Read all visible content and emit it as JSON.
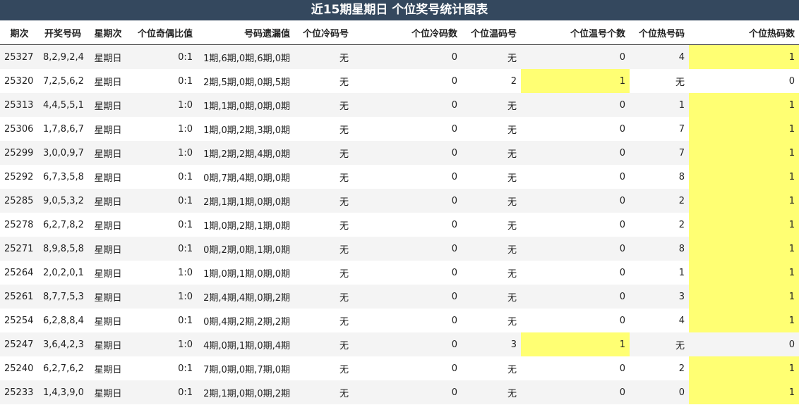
{
  "title": "近15期星期日 个位奖号统计图表",
  "columns": [
    "期次",
    "开奖号码",
    "星期次",
    "个位奇偶比值",
    "号码遗漏值",
    "个位冷码号",
    "个位冷码数",
    "个位温码号",
    "个位温号个数",
    "个位热号码",
    "个位热码数"
  ],
  "rows": [
    {
      "issue": "25327",
      "numbers": "8,2,9,2,4",
      "weekday": "星期日",
      "odd_even": "0:1",
      "omission": "1期,6期,0期,6期,0期",
      "cold_num": "无",
      "cold_count": "0",
      "warm_num": "无",
      "warm_count": "0",
      "hot_num": "4",
      "hot_count": "1"
    },
    {
      "issue": "25320",
      "numbers": "7,2,5,6,2",
      "weekday": "星期日",
      "odd_even": "0:1",
      "omission": "2期,5期,0期,0期,5期",
      "cold_num": "无",
      "cold_count": "0",
      "warm_num": "2",
      "warm_count": "1",
      "hot_num": "无",
      "hot_count": "0"
    },
    {
      "issue": "25313",
      "numbers": "4,4,5,5,1",
      "weekday": "星期日",
      "odd_even": "1:0",
      "omission": "1期,1期,0期,0期,0期",
      "cold_num": "无",
      "cold_count": "0",
      "warm_num": "无",
      "warm_count": "0",
      "hot_num": "1",
      "hot_count": "1"
    },
    {
      "issue": "25306",
      "numbers": "1,7,8,6,7",
      "weekday": "星期日",
      "odd_even": "1:0",
      "omission": "1期,0期,2期,3期,0期",
      "cold_num": "无",
      "cold_count": "0",
      "warm_num": "无",
      "warm_count": "0",
      "hot_num": "7",
      "hot_count": "1"
    },
    {
      "issue": "25299",
      "numbers": "3,0,0,9,7",
      "weekday": "星期日",
      "odd_even": "1:0",
      "omission": "1期,2期,2期,4期,0期",
      "cold_num": "无",
      "cold_count": "0",
      "warm_num": "无",
      "warm_count": "0",
      "hot_num": "7",
      "hot_count": "1"
    },
    {
      "issue": "25292",
      "numbers": "6,7,3,5,8",
      "weekday": "星期日",
      "odd_even": "0:1",
      "omission": "0期,7期,4期,0期,0期",
      "cold_num": "无",
      "cold_count": "0",
      "warm_num": "无",
      "warm_count": "0",
      "hot_num": "8",
      "hot_count": "1"
    },
    {
      "issue": "25285",
      "numbers": "9,0,5,3,2",
      "weekday": "星期日",
      "odd_even": "0:1",
      "omission": "2期,1期,1期,0期,0期",
      "cold_num": "无",
      "cold_count": "0",
      "warm_num": "无",
      "warm_count": "0",
      "hot_num": "2",
      "hot_count": "1"
    },
    {
      "issue": "25278",
      "numbers": "6,2,7,8,2",
      "weekday": "星期日",
      "odd_even": "0:1",
      "omission": "1期,0期,2期,1期,0期",
      "cold_num": "无",
      "cold_count": "0",
      "warm_num": "无",
      "warm_count": "0",
      "hot_num": "2",
      "hot_count": "1"
    },
    {
      "issue": "25271",
      "numbers": "8,9,8,5,8",
      "weekday": "星期日",
      "odd_even": "0:1",
      "omission": "0期,2期,0期,1期,0期",
      "cold_num": "无",
      "cold_count": "0",
      "warm_num": "无",
      "warm_count": "0",
      "hot_num": "8",
      "hot_count": "1"
    },
    {
      "issue": "25264",
      "numbers": "2,0,2,0,1",
      "weekday": "星期日",
      "odd_even": "1:0",
      "omission": "1期,0期,1期,0期,0期",
      "cold_num": "无",
      "cold_count": "0",
      "warm_num": "无",
      "warm_count": "0",
      "hot_num": "1",
      "hot_count": "1"
    },
    {
      "issue": "25261",
      "numbers": "8,7,7,5,3",
      "weekday": "星期日",
      "odd_even": "1:0",
      "omission": "2期,4期,4期,0期,2期",
      "cold_num": "无",
      "cold_count": "0",
      "warm_num": "无",
      "warm_count": "0",
      "hot_num": "3",
      "hot_count": "1"
    },
    {
      "issue": "25254",
      "numbers": "6,2,8,8,4",
      "weekday": "星期日",
      "odd_even": "0:1",
      "omission": "0期,4期,2期,2期,2期",
      "cold_num": "无",
      "cold_count": "0",
      "warm_num": "无",
      "warm_count": "0",
      "hot_num": "4",
      "hot_count": "1"
    },
    {
      "issue": "25247",
      "numbers": "3,6,4,2,3",
      "weekday": "星期日",
      "odd_even": "1:0",
      "omission": "4期,0期,1期,0期,4期",
      "cold_num": "无",
      "cold_count": "0",
      "warm_num": "3",
      "warm_count": "1",
      "hot_num": "无",
      "hot_count": "0"
    },
    {
      "issue": "25240",
      "numbers": "6,2,7,6,2",
      "weekday": "星期日",
      "odd_even": "0:1",
      "omission": "7期,0期,0期,7期,0期",
      "cold_num": "无",
      "cold_count": "0",
      "warm_num": "无",
      "warm_count": "0",
      "hot_num": "2",
      "hot_count": "1"
    },
    {
      "issue": "25233",
      "numbers": "1,4,3,9,0",
      "weekday": "星期日",
      "odd_even": "0:1",
      "omission": "2期,1期,0期,0期,2期",
      "cold_num": "无",
      "cold_count": "0",
      "warm_num": "无",
      "warm_count": "0",
      "hot_num": "0",
      "hot_count": "1"
    }
  ],
  "colors": {
    "title_bg": "#34485e",
    "title_text": "#ffffff",
    "highlight": "#ffff73",
    "row_alt": "#f4f4f4"
  }
}
